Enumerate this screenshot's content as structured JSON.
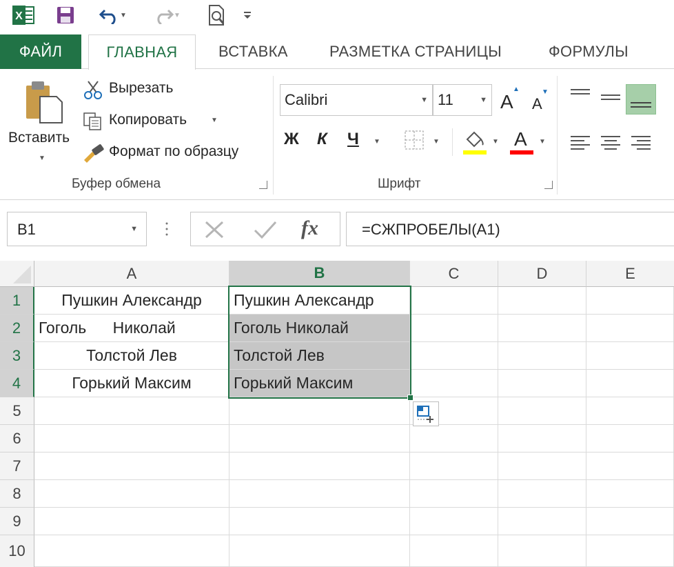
{
  "quick_access": {
    "icons": [
      "excel-logo-icon",
      "save-icon",
      "undo-icon",
      "redo-icon",
      "print-preview-icon",
      "customize-icon"
    ],
    "app_badge": "X"
  },
  "tabs": [
    "ФАЙЛ",
    "ГЛАВНАЯ",
    "ВСТАВКА",
    "РАЗМЕТКА СТРАНИЦЫ",
    "ФОРМУЛЫ"
  ],
  "ribbon": {
    "clipboard": {
      "paste": "Вставить",
      "cut": "Вырезать",
      "copy": "Копировать",
      "format_painter": "Формат по образцу",
      "label": "Буфер обмена"
    },
    "font": {
      "name": "Calibri",
      "size": "11",
      "grow": "A",
      "shrink": "A",
      "bold": "Ж",
      "italic": "К",
      "underline": "Ч",
      "font_color_letter": "A",
      "label": "Шрифт",
      "fill_color": "#ffff00",
      "font_color": "#ff0000"
    }
  },
  "formula_bar": {
    "name_box": "B1",
    "fx": "fx",
    "formula": "=СЖПРОБЕЛЫ(A1)"
  },
  "sheet": {
    "columns": [
      "A",
      "B",
      "C",
      "D",
      "E"
    ],
    "rows": [
      "1",
      "2",
      "3",
      "4",
      "5",
      "6",
      "7",
      "8",
      "9",
      "10"
    ],
    "col_a": [
      "Пушкин Александр",
      "Гоголь      Николай",
      "Толстой Лев",
      "Горький Максим"
    ],
    "col_b": [
      "Пушкин Александр",
      "Гоголь Николай",
      "Толстой Лев",
      "Горький Максим"
    ],
    "selected_range": "B1:B4",
    "accent": "#217346"
  }
}
